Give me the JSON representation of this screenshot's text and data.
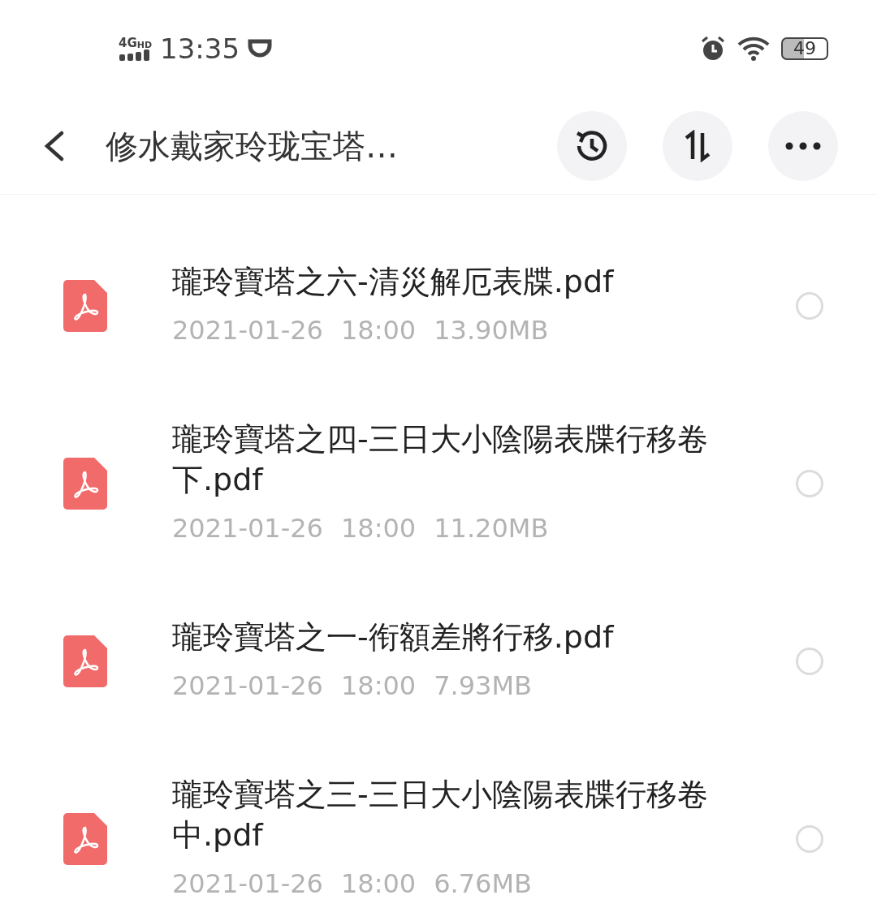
{
  "status_bar": {
    "network": "4G",
    "hd": "HD",
    "time": "13:35",
    "battery": "49"
  },
  "header": {
    "title": "修水戴家玲珑宝塔…"
  },
  "files": [
    {
      "name": "瓏玲寶塔之六-清災解厄表牒.pdf",
      "date": "2021-01-26",
      "time": "18:00",
      "size": "13.90MB",
      "selected": false
    },
    {
      "name": "瓏玲寶塔之四-三日大小陰陽表牒行移卷下.pdf",
      "date": "2021-01-26",
      "time": "18:00",
      "size": "11.20MB",
      "selected": false
    },
    {
      "name": "瓏玲寶塔之一-衔額差將行移.pdf",
      "date": "2021-01-26",
      "time": "18:00",
      "size": "7.93MB",
      "selected": false
    },
    {
      "name": "瓏玲寶塔之三-三日大小陰陽表牒行移卷中.pdf",
      "date": "2021-01-26",
      "time": "18:00",
      "size": "6.76MB",
      "selected": false
    }
  ]
}
